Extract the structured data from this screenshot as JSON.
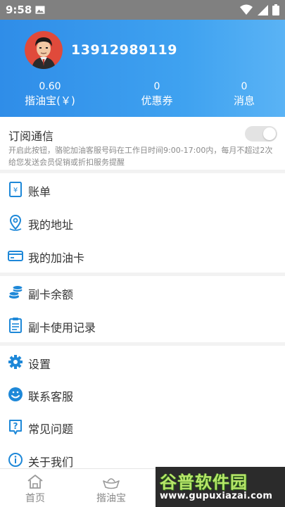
{
  "status_bar": {
    "time": "9:58",
    "icons": [
      "image-icon",
      "wifi-icon",
      "signal-icon",
      "battery-icon"
    ]
  },
  "header": {
    "phone": "13912989119",
    "stats": [
      {
        "value": "0.60",
        "label": "揩油宝(￥)"
      },
      {
        "value": "0",
        "label": "优惠券"
      },
      {
        "value": "0",
        "label": "消息"
      }
    ]
  },
  "subscribe": {
    "title": "订阅通信",
    "description": "开启此按钮，骆驼加油客服号码在工作日时间9:00-17:00内，每月不超过2次给您发送会员促销或折扣服务提醒",
    "enabled": false
  },
  "menu_groups": [
    [
      {
        "icon": "bill-icon",
        "label": "账单"
      },
      {
        "icon": "location-icon",
        "label": "我的地址"
      },
      {
        "icon": "card-icon",
        "label": "我的加油卡"
      }
    ],
    [
      {
        "icon": "coins-icon",
        "label": "副卡余额"
      },
      {
        "icon": "record-icon",
        "label": "副卡使用记录"
      }
    ],
    [
      {
        "icon": "settings-icon",
        "label": "设置"
      },
      {
        "icon": "customer-service-icon",
        "label": "联系客服"
      },
      {
        "icon": "faq-icon",
        "label": "常见问题"
      },
      {
        "icon": "info-icon",
        "label": "关于我们"
      }
    ]
  ],
  "bottom_nav": [
    {
      "icon": "home-icon",
      "label": "首页"
    },
    {
      "icon": "ingot-icon",
      "label": "揩油宝"
    }
  ],
  "watermark": {
    "title": "谷普软件园",
    "url": "www.gupuxiazai.com"
  },
  "colors": {
    "accent": "#2f8de8",
    "icon_blue": "#1e88d8",
    "watermark_green": "#b7e56a"
  }
}
